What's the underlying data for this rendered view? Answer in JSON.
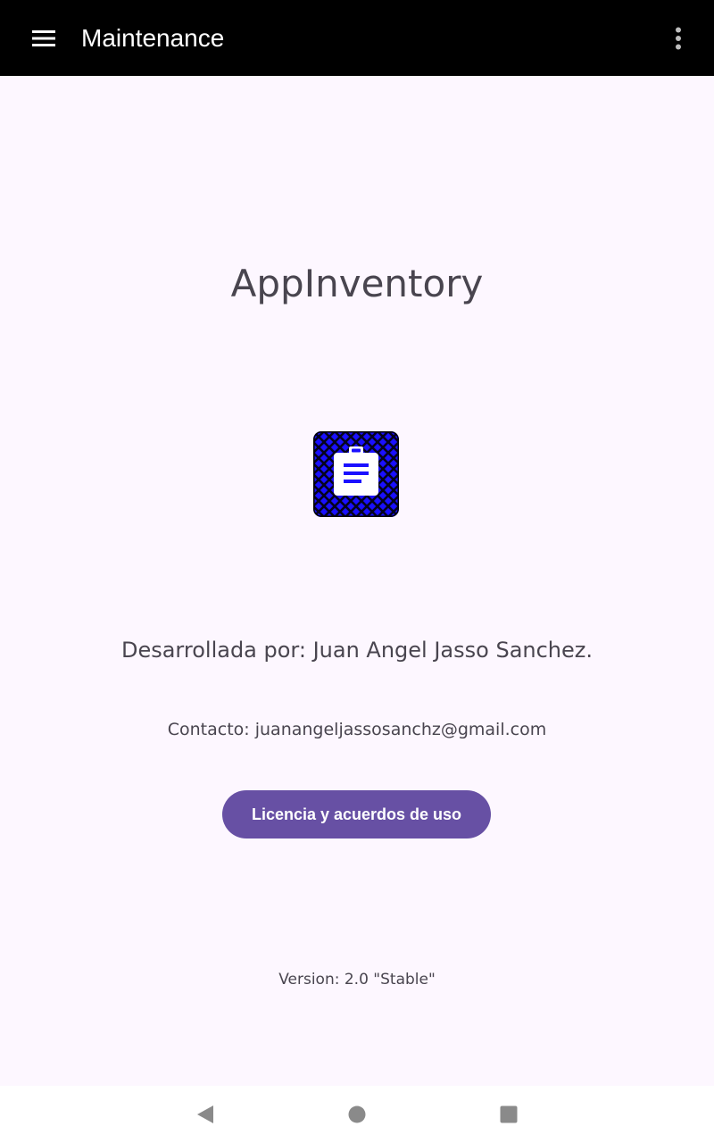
{
  "toolbar": {
    "title": "Maintenance",
    "menu_icon": "hamburger-menu-icon",
    "overflow_icon": "more-vertical-icon"
  },
  "about": {
    "app_name": "AppInventory",
    "logo_icon": "clipboard-icon",
    "developer": "Desarrollada por: Juan Angel Jasso Sanchez.",
    "contact": "Contacto: juanangeljassosanchz@gmail.com",
    "license_button": "Licencia y acuerdos de uso",
    "version": "Version: 2.0 \"Stable\""
  },
  "navbar": {
    "back_icon": "back-triangle-icon",
    "home_icon": "home-circle-icon",
    "recents_icon": "recents-square-icon"
  },
  "colors": {
    "toolbar_bg": "#000000",
    "page_bg": "#fdf7ff",
    "text": "#49454f",
    "button_bg": "#6750a4",
    "logo_blue": "#1a10ff"
  }
}
